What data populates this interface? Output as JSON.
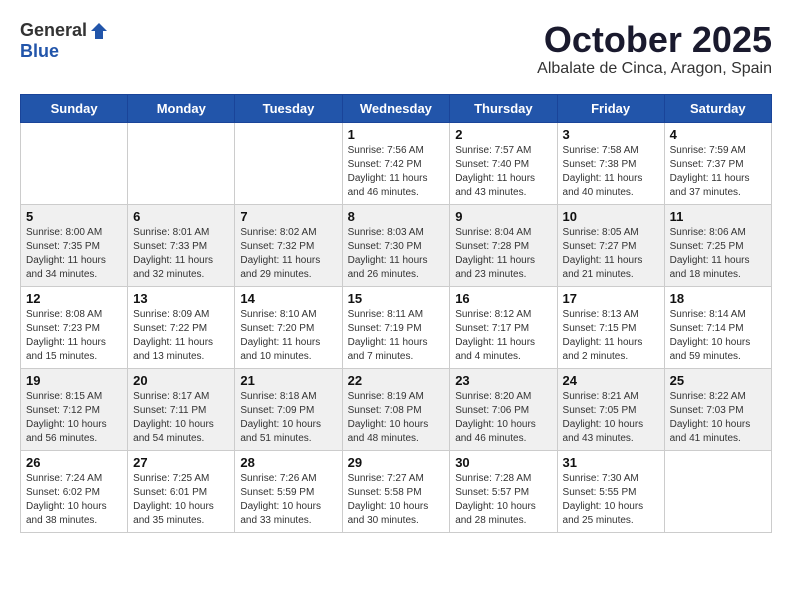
{
  "header": {
    "logo_general": "General",
    "logo_blue": "Blue",
    "month_title": "October 2025",
    "location": "Albalate de Cinca, Aragon, Spain"
  },
  "weekdays": [
    "Sunday",
    "Monday",
    "Tuesday",
    "Wednesday",
    "Thursday",
    "Friday",
    "Saturday"
  ],
  "weeks": [
    [
      {
        "day": "",
        "sunrise": "",
        "sunset": "",
        "daylight": ""
      },
      {
        "day": "",
        "sunrise": "",
        "sunset": "",
        "daylight": ""
      },
      {
        "day": "",
        "sunrise": "",
        "sunset": "",
        "daylight": ""
      },
      {
        "day": "1",
        "sunrise": "Sunrise: 7:56 AM",
        "sunset": "Sunset: 7:42 PM",
        "daylight": "Daylight: 11 hours and 46 minutes."
      },
      {
        "day": "2",
        "sunrise": "Sunrise: 7:57 AM",
        "sunset": "Sunset: 7:40 PM",
        "daylight": "Daylight: 11 hours and 43 minutes."
      },
      {
        "day": "3",
        "sunrise": "Sunrise: 7:58 AM",
        "sunset": "Sunset: 7:38 PM",
        "daylight": "Daylight: 11 hours and 40 minutes."
      },
      {
        "day": "4",
        "sunrise": "Sunrise: 7:59 AM",
        "sunset": "Sunset: 7:37 PM",
        "daylight": "Daylight: 11 hours and 37 minutes."
      }
    ],
    [
      {
        "day": "5",
        "sunrise": "Sunrise: 8:00 AM",
        "sunset": "Sunset: 7:35 PM",
        "daylight": "Daylight: 11 hours and 34 minutes."
      },
      {
        "day": "6",
        "sunrise": "Sunrise: 8:01 AM",
        "sunset": "Sunset: 7:33 PM",
        "daylight": "Daylight: 11 hours and 32 minutes."
      },
      {
        "day": "7",
        "sunrise": "Sunrise: 8:02 AM",
        "sunset": "Sunset: 7:32 PM",
        "daylight": "Daylight: 11 hours and 29 minutes."
      },
      {
        "day": "8",
        "sunrise": "Sunrise: 8:03 AM",
        "sunset": "Sunset: 7:30 PM",
        "daylight": "Daylight: 11 hours and 26 minutes."
      },
      {
        "day": "9",
        "sunrise": "Sunrise: 8:04 AM",
        "sunset": "Sunset: 7:28 PM",
        "daylight": "Daylight: 11 hours and 23 minutes."
      },
      {
        "day": "10",
        "sunrise": "Sunrise: 8:05 AM",
        "sunset": "Sunset: 7:27 PM",
        "daylight": "Daylight: 11 hours and 21 minutes."
      },
      {
        "day": "11",
        "sunrise": "Sunrise: 8:06 AM",
        "sunset": "Sunset: 7:25 PM",
        "daylight": "Daylight: 11 hours and 18 minutes."
      }
    ],
    [
      {
        "day": "12",
        "sunrise": "Sunrise: 8:08 AM",
        "sunset": "Sunset: 7:23 PM",
        "daylight": "Daylight: 11 hours and 15 minutes."
      },
      {
        "day": "13",
        "sunrise": "Sunrise: 8:09 AM",
        "sunset": "Sunset: 7:22 PM",
        "daylight": "Daylight: 11 hours and 13 minutes."
      },
      {
        "day": "14",
        "sunrise": "Sunrise: 8:10 AM",
        "sunset": "Sunset: 7:20 PM",
        "daylight": "Daylight: 11 hours and 10 minutes."
      },
      {
        "day": "15",
        "sunrise": "Sunrise: 8:11 AM",
        "sunset": "Sunset: 7:19 PM",
        "daylight": "Daylight: 11 hours and 7 minutes."
      },
      {
        "day": "16",
        "sunrise": "Sunrise: 8:12 AM",
        "sunset": "Sunset: 7:17 PM",
        "daylight": "Daylight: 11 hours and 4 minutes."
      },
      {
        "day": "17",
        "sunrise": "Sunrise: 8:13 AM",
        "sunset": "Sunset: 7:15 PM",
        "daylight": "Daylight: 11 hours and 2 minutes."
      },
      {
        "day": "18",
        "sunrise": "Sunrise: 8:14 AM",
        "sunset": "Sunset: 7:14 PM",
        "daylight": "Daylight: 10 hours and 59 minutes."
      }
    ],
    [
      {
        "day": "19",
        "sunrise": "Sunrise: 8:15 AM",
        "sunset": "Sunset: 7:12 PM",
        "daylight": "Daylight: 10 hours and 56 minutes."
      },
      {
        "day": "20",
        "sunrise": "Sunrise: 8:17 AM",
        "sunset": "Sunset: 7:11 PM",
        "daylight": "Daylight: 10 hours and 54 minutes."
      },
      {
        "day": "21",
        "sunrise": "Sunrise: 8:18 AM",
        "sunset": "Sunset: 7:09 PM",
        "daylight": "Daylight: 10 hours and 51 minutes."
      },
      {
        "day": "22",
        "sunrise": "Sunrise: 8:19 AM",
        "sunset": "Sunset: 7:08 PM",
        "daylight": "Daylight: 10 hours and 48 minutes."
      },
      {
        "day": "23",
        "sunrise": "Sunrise: 8:20 AM",
        "sunset": "Sunset: 7:06 PM",
        "daylight": "Daylight: 10 hours and 46 minutes."
      },
      {
        "day": "24",
        "sunrise": "Sunrise: 8:21 AM",
        "sunset": "Sunset: 7:05 PM",
        "daylight": "Daylight: 10 hours and 43 minutes."
      },
      {
        "day": "25",
        "sunrise": "Sunrise: 8:22 AM",
        "sunset": "Sunset: 7:03 PM",
        "daylight": "Daylight: 10 hours and 41 minutes."
      }
    ],
    [
      {
        "day": "26",
        "sunrise": "Sunrise: 7:24 AM",
        "sunset": "Sunset: 6:02 PM",
        "daylight": "Daylight: 10 hours and 38 minutes."
      },
      {
        "day": "27",
        "sunrise": "Sunrise: 7:25 AM",
        "sunset": "Sunset: 6:01 PM",
        "daylight": "Daylight: 10 hours and 35 minutes."
      },
      {
        "day": "28",
        "sunrise": "Sunrise: 7:26 AM",
        "sunset": "Sunset: 5:59 PM",
        "daylight": "Daylight: 10 hours and 33 minutes."
      },
      {
        "day": "29",
        "sunrise": "Sunrise: 7:27 AM",
        "sunset": "Sunset: 5:58 PM",
        "daylight": "Daylight: 10 hours and 30 minutes."
      },
      {
        "day": "30",
        "sunrise": "Sunrise: 7:28 AM",
        "sunset": "Sunset: 5:57 PM",
        "daylight": "Daylight: 10 hours and 28 minutes."
      },
      {
        "day": "31",
        "sunrise": "Sunrise: 7:30 AM",
        "sunset": "Sunset: 5:55 PM",
        "daylight": "Daylight: 10 hours and 25 minutes."
      },
      {
        "day": "",
        "sunrise": "",
        "sunset": "",
        "daylight": ""
      }
    ]
  ]
}
